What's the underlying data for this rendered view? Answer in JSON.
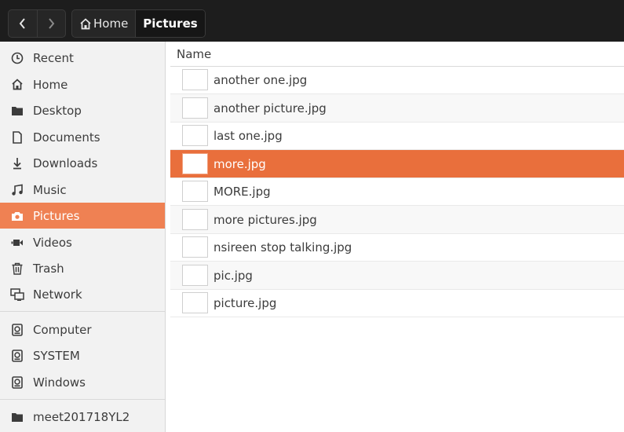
{
  "toolbar": {
    "back_icon": "chevron-left-icon",
    "forward_icon": "chevron-right-icon",
    "breadcrumbs": [
      {
        "label": "Home",
        "icon": "home-icon"
      },
      {
        "label": "Pictures"
      }
    ]
  },
  "sidebar": {
    "items": [
      {
        "label": "Recent",
        "icon": "clock-icon"
      },
      {
        "label": "Home",
        "icon": "home-icon"
      },
      {
        "label": "Desktop",
        "icon": "folder-icon"
      },
      {
        "label": "Documents",
        "icon": "document-icon"
      },
      {
        "label": "Downloads",
        "icon": "download-icon"
      },
      {
        "label": "Music",
        "icon": "music-icon"
      },
      {
        "label": "Pictures",
        "icon": "camera-icon",
        "selected": true
      },
      {
        "label": "Videos",
        "icon": "video-icon"
      },
      {
        "label": "Trash",
        "icon": "trash-icon"
      },
      {
        "label": "Network",
        "icon": "network-icon"
      }
    ],
    "devices": [
      {
        "label": "Computer",
        "icon": "drive-icon"
      },
      {
        "label": "SYSTEM",
        "icon": "drive-icon"
      },
      {
        "label": "Windows",
        "icon": "drive-icon"
      }
    ],
    "bookmarks": [
      {
        "label": "meet201718YL2",
        "icon": "folder-icon"
      }
    ]
  },
  "main": {
    "column_header": "Name",
    "files": [
      "another one.jpg",
      "another picture.jpg",
      "last one.jpg",
      "more.jpg",
      "MORE.jpg",
      "more pictures.jpg",
      "nsireen stop talking.jpg",
      "pic.jpg",
      "picture.jpg"
    ],
    "selected_file": "more.jpg"
  },
  "colors": {
    "accent": "#e96f3c",
    "sidebar_selected": "#ef8153",
    "toolbar_bg": "#1d1d1d"
  }
}
